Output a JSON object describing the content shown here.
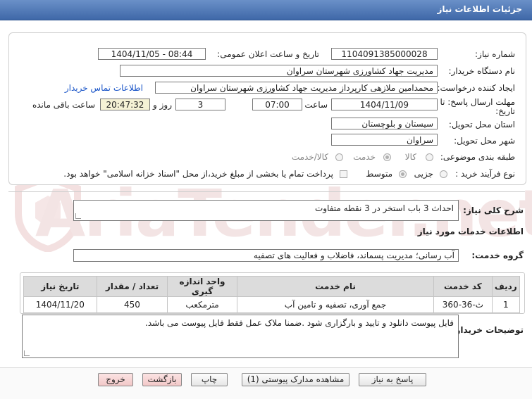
{
  "window": {
    "title": "جزئیات اطلاعات نیاز"
  },
  "watermark": {
    "text": "AriaTender.net"
  },
  "form": {
    "need_number": {
      "label": "شماره نیاز:",
      "value": "1104091385000028"
    },
    "announce_datetime": {
      "label": "تاریخ و ساعت اعلان عمومی:",
      "value": "1404/11/05 - 08:44"
    },
    "buyer_org": {
      "label": "نام دستگاه خریدار:",
      "value": "مدیریت جهاد کشاورزی شهرستان سراوان"
    },
    "requester": {
      "label": "ایجاد کننده درخواست:",
      "value": "محمدامین  ملازهی  کارپرداز مدیریت جهاد کشاورزی شهرستان سراوان"
    },
    "buyer_contact_link": "اطلاعات تماس خریدار",
    "deadline": {
      "label_line1": "مهلت ارسال پاسخ: تا",
      "label_line2": "تاریخ:",
      "date": "1404/11/09",
      "time_label": "ساعت",
      "time": "07:00",
      "days": "3",
      "days_label": "روز و",
      "remaining": "20:47:32",
      "remaining_label": "ساعت باقی مانده"
    },
    "province": {
      "label": "استان محل تحویل:",
      "value": "سیستان و بلوچستان"
    },
    "city": {
      "label": "شهر محل تحویل:",
      "value": "سراوان"
    },
    "category": {
      "label": "طبقه بندی موضوعی:",
      "options": [
        "کالا",
        "خدمت",
        "کالا/خدمت"
      ],
      "selected": "خدمت"
    },
    "process_type": {
      "label": "نوع فرآیند خرید :",
      "options": [
        "جزیی",
        "متوسط"
      ],
      "selected": "متوسط",
      "payment_note": "پرداخت تمام یا بخشی از مبلغ خرید،از محل \"اسناد خزانه اسلامی\" خواهد بود."
    }
  },
  "summary": {
    "label": "شرح کلی نیاز:",
    "value": "احداث 3 باب استخر در 3 نقطه متفاوت"
  },
  "services": {
    "heading": "اطلاعات خدمات مورد نیاز",
    "group_label": "گروه خدمت:",
    "group_value": "آب رسانی؛ مدیریت پسماند، فاضلاب و فعالیت های تصفیه"
  },
  "table": {
    "headers": [
      "ردیف",
      "کد خدمت",
      "نام خدمت",
      "واحد اندازه گیری",
      "تعداد / مقدار",
      "تاریخ نیاز"
    ],
    "rows": [
      [
        "1",
        "ث-36-360",
        "جمع آوری، تصفیه و تامین آب",
        "مترمکعب",
        "450",
        "1404/11/20"
      ]
    ]
  },
  "buyer_notes": {
    "label": "توضیحات خریدار:",
    "value": "فایل پیوست دانلود و تایید و بارگزاری شود .ضمنا ملاک عمل فقط فایل پیوست می باشد."
  },
  "buttons": {
    "reply": "پاسخ به نیاز",
    "view_docs": "مشاهده مدارک پیوستی (1)",
    "print": "چاپ",
    "back": "بازگشت",
    "exit": "خروج"
  }
}
